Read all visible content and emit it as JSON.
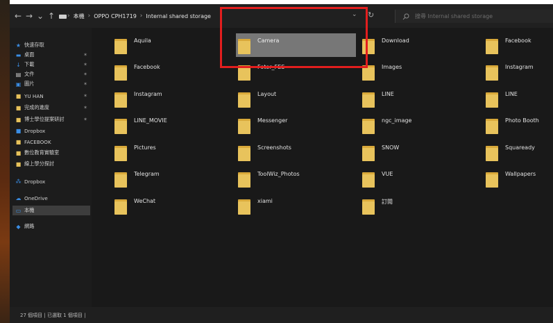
{
  "addressbar": {
    "nav": {
      "back": "←",
      "forward": "→",
      "recent": "⌄",
      "up": "↑"
    },
    "crumbs": [
      "本機",
      "OPPO CPH1719",
      "Internal shared storage"
    ],
    "search_placeholder": "搜尋 Internal shared storage"
  },
  "sidebar": {
    "items": [
      {
        "label": "快速存取",
        "icon": "star-icon",
        "color": "#3a8ee6",
        "pinned": false
      },
      {
        "label": "桌面",
        "icon": "desktop-icon",
        "color": "#3a8ee6",
        "pinned": true
      },
      {
        "label": "下載",
        "icon": "download-icon",
        "color": "#3a8ee6",
        "pinned": true
      },
      {
        "label": "文件",
        "icon": "document-icon",
        "color": "#cfcfcf",
        "pinned": true
      },
      {
        "label": "圖片",
        "icon": "picture-icon",
        "color": "#3a8ee6",
        "pinned": true
      },
      {
        "label": "YU HAN",
        "icon": "folder-icon",
        "color": "#e6c15a",
        "pinned": true
      },
      {
        "label": "完成的進度",
        "icon": "folder-icon",
        "color": "#e6c15a",
        "pinned": true
      },
      {
        "label": "博士學位提案研討",
        "icon": "folder-icon",
        "color": "#e6c15a",
        "pinned": true
      },
      {
        "label": "Dropbox",
        "icon": "dropbox-folder-icon",
        "color": "#3a8ee6",
        "pinned": false
      },
      {
        "label": "FACEBOOK",
        "icon": "folder-icon",
        "color": "#e6c15a",
        "pinned": false
      },
      {
        "label": "數位教育實驗室",
        "icon": "folder-icon",
        "color": "#e6c15a",
        "pinned": false
      },
      {
        "label": "線上學分探討",
        "icon": "folder-icon",
        "color": "#e6c15a",
        "pinned": false
      },
      {
        "label": "Dropbox",
        "icon": "dropbox-icon",
        "color": "#3a8ee6",
        "pinned": false
      },
      {
        "label": "OneDrive",
        "icon": "cloud-icon",
        "color": "#3a8ee6",
        "pinned": false
      },
      {
        "label": "本機",
        "icon": "computer-icon",
        "color": "#3a8ee6",
        "pinned": false,
        "selected": true
      },
      {
        "label": "網路",
        "icon": "network-icon",
        "color": "#3a8ee6",
        "pinned": false
      }
    ]
  },
  "folders": [
    "Aquila",
    "Camera",
    "Download",
    "Facebook",
    "Facebook",
    "Fotor_FES",
    "Images",
    "Instagram",
    "Instagram",
    "Layout",
    "LINE",
    "LINE",
    "LINE_MOVIE",
    "Messenger",
    "ngc_image",
    "Photo Booth",
    "Pictures",
    "Screenshots",
    "SNOW",
    "Squaready",
    "Telegram",
    "ToolWiz_Photos",
    "VUE",
    "Wallpapers",
    "WeChat",
    "xiami",
    "訂閱"
  ],
  "selected_folder": "Camera",
  "statusbar": {
    "text": "27 個項目  |  已選取 1 個項目  |"
  },
  "colors": {
    "folder": "#e8c35c",
    "folder_dark": "#d9a93a",
    "highlight": "#e31e1e",
    "selection": "#777777"
  }
}
